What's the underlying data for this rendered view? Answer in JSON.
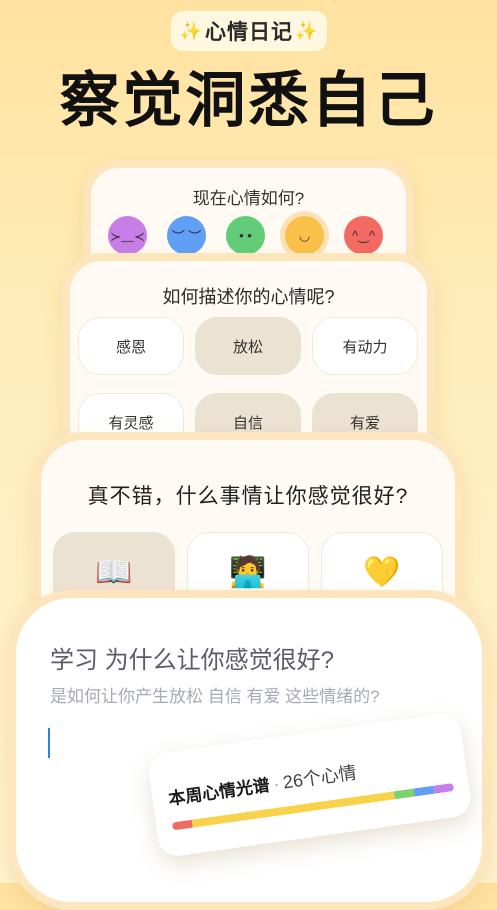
{
  "header": {
    "badge": "心情日记",
    "headline": "察觉洞悉自己"
  },
  "mood_card": {
    "title": "现在心情如何?",
    "faces": [
      {
        "name": "awful-face-icon",
        "color": "#c77ee6",
        "glyph": "≻﹏≺"
      },
      {
        "name": "sad-face-icon",
        "color": "#5f9ff5",
        "glyph": "︶ ︶"
      },
      {
        "name": "neutral-face-icon",
        "color": "#62cc78",
        "glyph": "• •"
      },
      {
        "name": "good-face-icon",
        "color": "#f9c14a",
        "glyph": "◡"
      },
      {
        "name": "great-face-icon",
        "color": "#f26a61",
        "glyph": "^‿^"
      }
    ],
    "selected_index": 3
  },
  "describe_card": {
    "title": "如何描述你的心情呢?",
    "tags": [
      "感恩",
      "放松",
      "有动力",
      "有灵感",
      "自信",
      "有爱"
    ]
  },
  "reason_card": {
    "title": "真不错，什么事情让你感觉很好?",
    "reasons": [
      {
        "icon": "book-icon",
        "glyph": "📖"
      },
      {
        "icon": "laptop-person-icon",
        "glyph": "🧑‍💻"
      },
      {
        "icon": "heart-icon",
        "glyph": "💛"
      }
    ]
  },
  "journal_card": {
    "question": "学习 为什么让你感觉很好?",
    "subtext": "是如何让你产生放松 自信 有爱 这些情绪的?"
  },
  "spectrum": {
    "title": "本周心情光谱",
    "dot": "·",
    "count": "26个心情",
    "segments": [
      {
        "color": "#f26a61",
        "share": 0.07
      },
      {
        "color": "#f8d24a",
        "share": 0.72
      },
      {
        "color": "#7dd36a",
        "share": 0.07
      },
      {
        "color": "#5f9ff5",
        "share": 0.07
      },
      {
        "color": "#c77ee6",
        "share": 0.07
      }
    ]
  }
}
